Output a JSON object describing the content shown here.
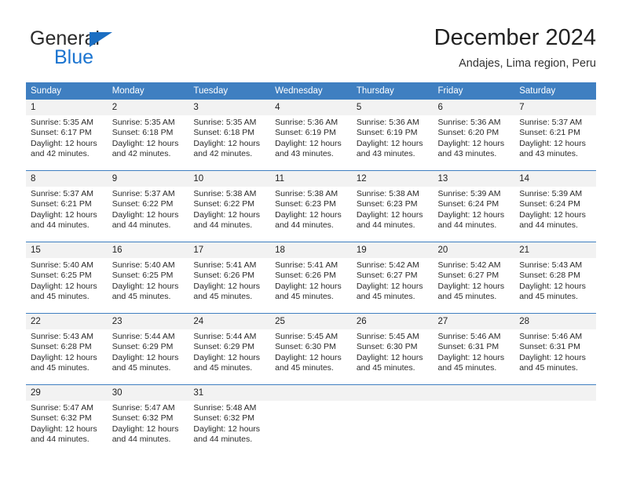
{
  "logo": {
    "word_top": "General",
    "word_bottom": "Blue",
    "triangle_color": "#1b6ec2",
    "blue_text_color": "#1b74d0"
  },
  "header": {
    "title": "December 2024",
    "subtitle": "Andajes, Lima region, Peru"
  },
  "theme": {
    "header_blue": "#3f7fc1",
    "daynum_band": "#f2f2f2",
    "text": "#222222"
  },
  "weekday_headers": [
    "Sunday",
    "Monday",
    "Tuesday",
    "Wednesday",
    "Thursday",
    "Friday",
    "Saturday"
  ],
  "labels": {
    "sunrise_prefix": "Sunrise:",
    "sunset_prefix": "Sunset:",
    "daylight_prefix": "Daylight:"
  },
  "weeks": [
    {
      "days": [
        {
          "date": "1",
          "sunrise": "Sunrise: 5:35 AM",
          "sunset": "Sunset: 6:17 PM",
          "daylight_a": "Daylight: 12 hours",
          "daylight_b": "and 42 minutes."
        },
        {
          "date": "2",
          "sunrise": "Sunrise: 5:35 AM",
          "sunset": "Sunset: 6:18 PM",
          "daylight_a": "Daylight: 12 hours",
          "daylight_b": "and 42 minutes."
        },
        {
          "date": "3",
          "sunrise": "Sunrise: 5:35 AM",
          "sunset": "Sunset: 6:18 PM",
          "daylight_a": "Daylight: 12 hours",
          "daylight_b": "and 42 minutes."
        },
        {
          "date": "4",
          "sunrise": "Sunrise: 5:36 AM",
          "sunset": "Sunset: 6:19 PM",
          "daylight_a": "Daylight: 12 hours",
          "daylight_b": "and 43 minutes."
        },
        {
          "date": "5",
          "sunrise": "Sunrise: 5:36 AM",
          "sunset": "Sunset: 6:19 PM",
          "daylight_a": "Daylight: 12 hours",
          "daylight_b": "and 43 minutes."
        },
        {
          "date": "6",
          "sunrise": "Sunrise: 5:36 AM",
          "sunset": "Sunset: 6:20 PM",
          "daylight_a": "Daylight: 12 hours",
          "daylight_b": "and 43 minutes."
        },
        {
          "date": "7",
          "sunrise": "Sunrise: 5:37 AM",
          "sunset": "Sunset: 6:21 PM",
          "daylight_a": "Daylight: 12 hours",
          "daylight_b": "and 43 minutes."
        }
      ]
    },
    {
      "days": [
        {
          "date": "8",
          "sunrise": "Sunrise: 5:37 AM",
          "sunset": "Sunset: 6:21 PM",
          "daylight_a": "Daylight: 12 hours",
          "daylight_b": "and 44 minutes."
        },
        {
          "date": "9",
          "sunrise": "Sunrise: 5:37 AM",
          "sunset": "Sunset: 6:22 PM",
          "daylight_a": "Daylight: 12 hours",
          "daylight_b": "and 44 minutes."
        },
        {
          "date": "10",
          "sunrise": "Sunrise: 5:38 AM",
          "sunset": "Sunset: 6:22 PM",
          "daylight_a": "Daylight: 12 hours",
          "daylight_b": "and 44 minutes."
        },
        {
          "date": "11",
          "sunrise": "Sunrise: 5:38 AM",
          "sunset": "Sunset: 6:23 PM",
          "daylight_a": "Daylight: 12 hours",
          "daylight_b": "and 44 minutes."
        },
        {
          "date": "12",
          "sunrise": "Sunrise: 5:38 AM",
          "sunset": "Sunset: 6:23 PM",
          "daylight_a": "Daylight: 12 hours",
          "daylight_b": "and 44 minutes."
        },
        {
          "date": "13",
          "sunrise": "Sunrise: 5:39 AM",
          "sunset": "Sunset: 6:24 PM",
          "daylight_a": "Daylight: 12 hours",
          "daylight_b": "and 44 minutes."
        },
        {
          "date": "14",
          "sunrise": "Sunrise: 5:39 AM",
          "sunset": "Sunset: 6:24 PM",
          "daylight_a": "Daylight: 12 hours",
          "daylight_b": "and 44 minutes."
        }
      ]
    },
    {
      "days": [
        {
          "date": "15",
          "sunrise": "Sunrise: 5:40 AM",
          "sunset": "Sunset: 6:25 PM",
          "daylight_a": "Daylight: 12 hours",
          "daylight_b": "and 45 minutes."
        },
        {
          "date": "16",
          "sunrise": "Sunrise: 5:40 AM",
          "sunset": "Sunset: 6:25 PM",
          "daylight_a": "Daylight: 12 hours",
          "daylight_b": "and 45 minutes."
        },
        {
          "date": "17",
          "sunrise": "Sunrise: 5:41 AM",
          "sunset": "Sunset: 6:26 PM",
          "daylight_a": "Daylight: 12 hours",
          "daylight_b": "and 45 minutes."
        },
        {
          "date": "18",
          "sunrise": "Sunrise: 5:41 AM",
          "sunset": "Sunset: 6:26 PM",
          "daylight_a": "Daylight: 12 hours",
          "daylight_b": "and 45 minutes."
        },
        {
          "date": "19",
          "sunrise": "Sunrise: 5:42 AM",
          "sunset": "Sunset: 6:27 PM",
          "daylight_a": "Daylight: 12 hours",
          "daylight_b": "and 45 minutes."
        },
        {
          "date": "20",
          "sunrise": "Sunrise: 5:42 AM",
          "sunset": "Sunset: 6:27 PM",
          "daylight_a": "Daylight: 12 hours",
          "daylight_b": "and 45 minutes."
        },
        {
          "date": "21",
          "sunrise": "Sunrise: 5:43 AM",
          "sunset": "Sunset: 6:28 PM",
          "daylight_a": "Daylight: 12 hours",
          "daylight_b": "and 45 minutes."
        }
      ]
    },
    {
      "days": [
        {
          "date": "22",
          "sunrise": "Sunrise: 5:43 AM",
          "sunset": "Sunset: 6:28 PM",
          "daylight_a": "Daylight: 12 hours",
          "daylight_b": "and 45 minutes."
        },
        {
          "date": "23",
          "sunrise": "Sunrise: 5:44 AM",
          "sunset": "Sunset: 6:29 PM",
          "daylight_a": "Daylight: 12 hours",
          "daylight_b": "and 45 minutes."
        },
        {
          "date": "24",
          "sunrise": "Sunrise: 5:44 AM",
          "sunset": "Sunset: 6:29 PM",
          "daylight_a": "Daylight: 12 hours",
          "daylight_b": "and 45 minutes."
        },
        {
          "date": "25",
          "sunrise": "Sunrise: 5:45 AM",
          "sunset": "Sunset: 6:30 PM",
          "daylight_a": "Daylight: 12 hours",
          "daylight_b": "and 45 minutes."
        },
        {
          "date": "26",
          "sunrise": "Sunrise: 5:45 AM",
          "sunset": "Sunset: 6:30 PM",
          "daylight_a": "Daylight: 12 hours",
          "daylight_b": "and 45 minutes."
        },
        {
          "date": "27",
          "sunrise": "Sunrise: 5:46 AM",
          "sunset": "Sunset: 6:31 PM",
          "daylight_a": "Daylight: 12 hours",
          "daylight_b": "and 45 minutes."
        },
        {
          "date": "28",
          "sunrise": "Sunrise: 5:46 AM",
          "sunset": "Sunset: 6:31 PM",
          "daylight_a": "Daylight: 12 hours",
          "daylight_b": "and 45 minutes."
        }
      ]
    },
    {
      "days": [
        {
          "date": "29",
          "sunrise": "Sunrise: 5:47 AM",
          "sunset": "Sunset: 6:32 PM",
          "daylight_a": "Daylight: 12 hours",
          "daylight_b": "and 44 minutes."
        },
        {
          "date": "30",
          "sunrise": "Sunrise: 5:47 AM",
          "sunset": "Sunset: 6:32 PM",
          "daylight_a": "Daylight: 12 hours",
          "daylight_b": "and 44 minutes."
        },
        {
          "date": "31",
          "sunrise": "Sunrise: 5:48 AM",
          "sunset": "Sunset: 6:32 PM",
          "daylight_a": "Daylight: 12 hours",
          "daylight_b": "and 44 minutes."
        },
        {
          "date": "",
          "sunrise": "",
          "sunset": "",
          "daylight_a": "",
          "daylight_b": ""
        },
        {
          "date": "",
          "sunrise": "",
          "sunset": "",
          "daylight_a": "",
          "daylight_b": ""
        },
        {
          "date": "",
          "sunrise": "",
          "sunset": "",
          "daylight_a": "",
          "daylight_b": ""
        },
        {
          "date": "",
          "sunrise": "",
          "sunset": "",
          "daylight_a": "",
          "daylight_b": ""
        }
      ]
    }
  ]
}
